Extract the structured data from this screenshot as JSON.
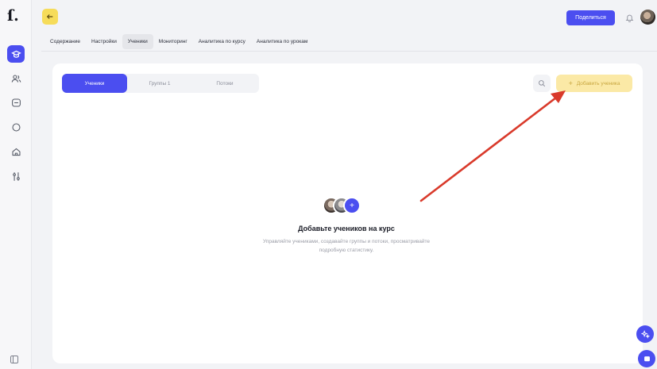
{
  "header": {
    "share_label": "Поделиться"
  },
  "tabs": [
    {
      "label": "Содержание"
    },
    {
      "label": "Настройки"
    },
    {
      "label": "Ученики",
      "active": true
    },
    {
      "label": "Мониторинг"
    },
    {
      "label": "Аналитика по курсу"
    },
    {
      "label": "Аналитика по урокам"
    }
  ],
  "segments": [
    {
      "label": "Ученики",
      "active": true
    },
    {
      "label": "Группы 1"
    },
    {
      "label": "Потоки"
    }
  ],
  "actions": {
    "add_student_label": "Добавить ученика"
  },
  "empty_state": {
    "title": "Добавьте учеников на курс",
    "description_line1": "Управляйте учениками, создавайте группы и потоки, просматривайте",
    "description_line2": "подробную статистику."
  },
  "colors": {
    "accent": "#4b4ef0",
    "yellow": "#f6dc5a",
    "annotation_arrow": "#d93a2b"
  },
  "icons": {
    "sidebar": [
      "course-icon",
      "users-icon",
      "chat-icon",
      "circle-icon",
      "home-icon",
      "settings-icon"
    ]
  }
}
